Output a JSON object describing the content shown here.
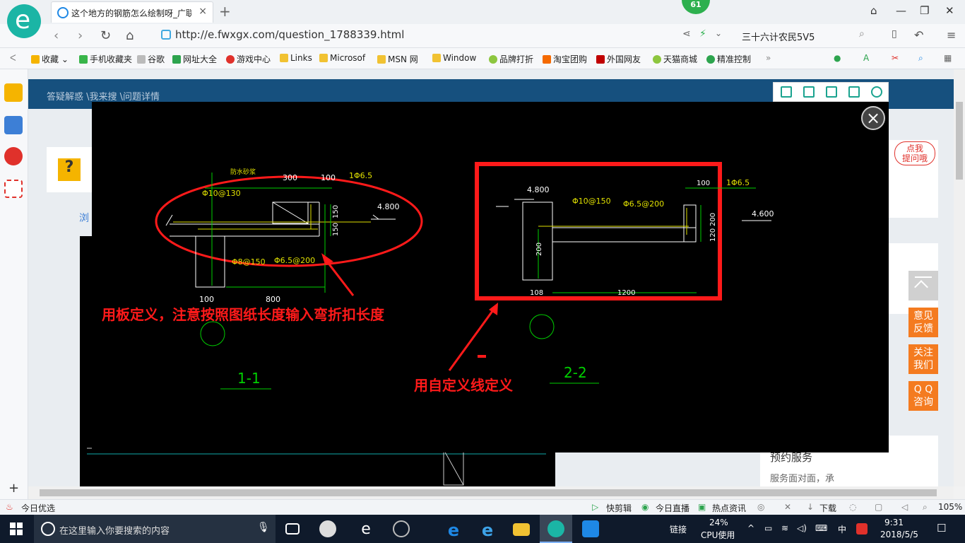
{
  "browser": {
    "tab_title": "这个地方的钢筋怎么绘制呀_广联",
    "tab_close": "×",
    "new_tab": "+",
    "badge": "61",
    "url": "http://e.fwxgx.com/question_1788339.html",
    "search_text": "三十六计农民5V5",
    "back": "‹",
    "forward": "›"
  },
  "bookmarks": [
    {
      "label": "收藏",
      "color": "#f5b400"
    },
    {
      "label": "手机收藏夹",
      "color": "#39b54a"
    },
    {
      "label": "谷歌",
      "color": "#999999"
    },
    {
      "label": "网址大全",
      "color": "#2da44e"
    },
    {
      "label": "游戏中心",
      "color": "#e0312b"
    },
    {
      "label": "Links",
      "color": "#f1c232"
    },
    {
      "label": "Microsof",
      "color": "#f1c232"
    },
    {
      "label": "MSN 网",
      "color": "#f1c232"
    },
    {
      "label": "Window",
      "color": "#f1c232"
    },
    {
      "label": "品牌打折",
      "color": "#8dc63f"
    },
    {
      "label": "淘宝团购",
      "color": "#f56a00"
    },
    {
      "label": "外国网友",
      "color": "#c00000"
    },
    {
      "label": "天猫商城",
      "color": "#8dc63f"
    },
    {
      "label": "精准控制",
      "color": "#2da44e"
    }
  ],
  "page": {
    "breadcrumb": "答疑解惑 \\我来搜 \\问题详情",
    "left_stub": "浏",
    "ask_bubble": "点我\n提问哦",
    "side_title": "预约服务",
    "side_text": "服务面对面，承",
    "feedback": "意见\n反馈",
    "follow": "关注\n我们",
    "qq": "Q Q\n咨询"
  },
  "drawing": {
    "annotation_left": "用板定义，注意按照图纸长度输入弯折扣长度",
    "annotation_right": "用自定义线定义",
    "label_11": "1-1",
    "label_22": "2-2",
    "s1": {
      "dim300": "300",
      "dim100": "100",
      "phi65": "1Φ6.5",
      "phi10": "Φ10@130",
      "elev": "4.800",
      "d150a": "150",
      "d150b": "150",
      "phi8": "Φ8@150",
      "phi65b": "Φ6.5@200",
      "d100": "100",
      "d800": "800",
      "note": "防水砂浆"
    },
    "s2": {
      "elev_l": "4.800",
      "d100": "100",
      "phi65": "1Φ6.5",
      "phi10": "Φ10@150",
      "phi65b": "Φ6.5@200",
      "elev_r": "4.600",
      "d200": "200",
      "d120": "120",
      "d200v": "200",
      "d108": "108",
      "d1200": "1200"
    }
  },
  "statusbar": {
    "left": "今日优选",
    "items": [
      "快剪辑",
      "今日直播",
      "热点资讯",
      "下载"
    ],
    "zoom": "105%"
  },
  "taskbar": {
    "search_placeholder": "在这里输入你要搜索的内容",
    "tray_link": "链接",
    "cpu_pct": "24%",
    "cpu_label": "CPU使用",
    "ime": "中",
    "time": "9:31",
    "date": "2018/5/5"
  }
}
